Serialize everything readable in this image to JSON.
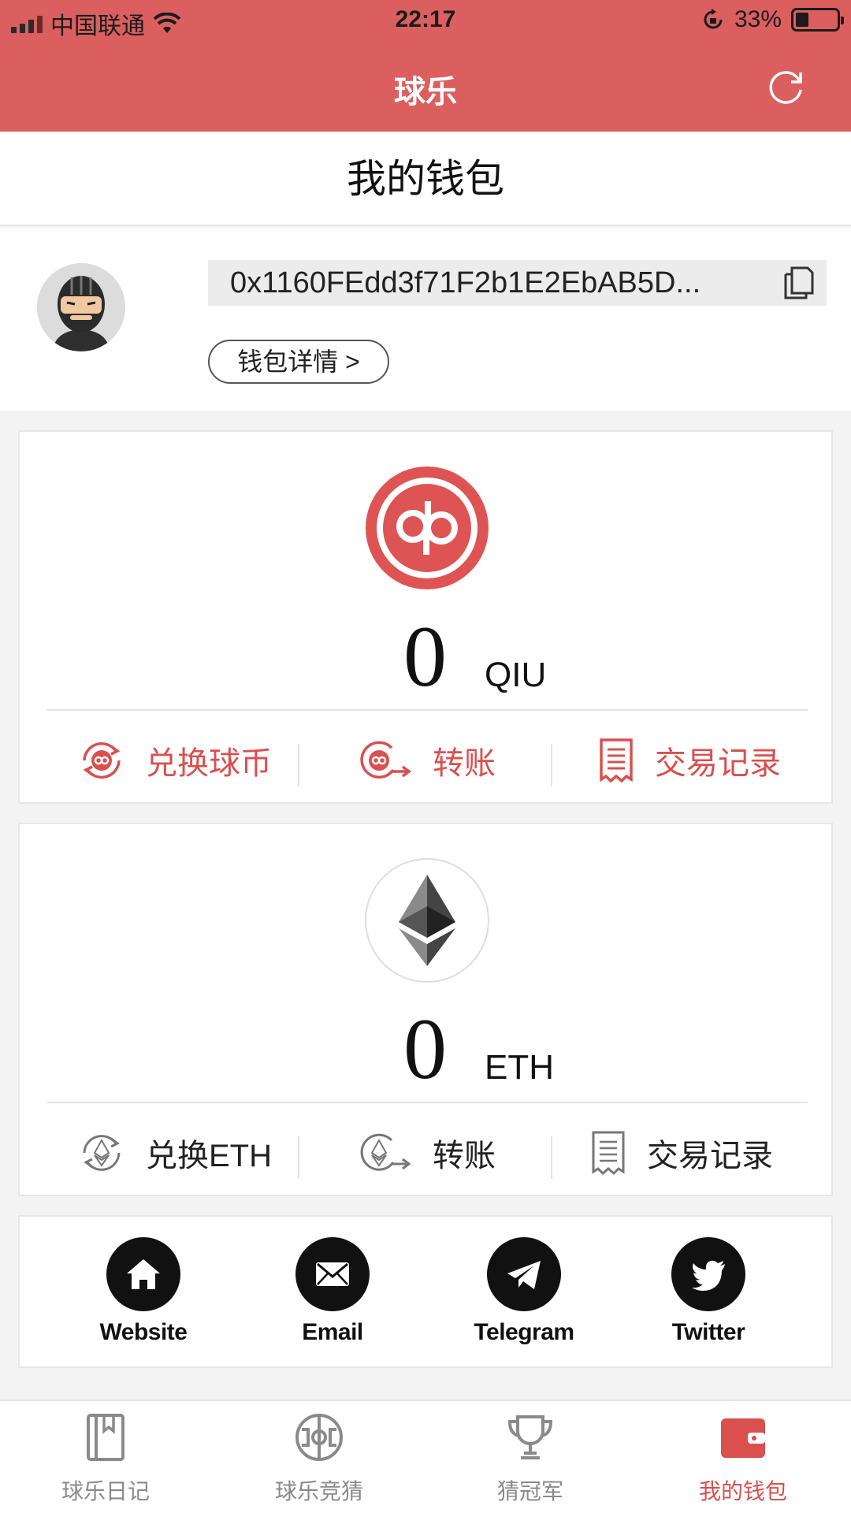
{
  "status_bar": {
    "carrier": "中国联通",
    "time": "22:17",
    "battery_percent": "33%"
  },
  "nav": {
    "title": "球乐",
    "refresh_icon": "refresh-icon"
  },
  "page_title": "我的钱包",
  "wallet": {
    "address": "0x1160FEdd3f71F2b1E2EbAB5D...",
    "detail_label": "钱包详情 >"
  },
  "coins": [
    {
      "amount": "0",
      "unit": "QIU",
      "accent": "#d9504f",
      "actions": [
        {
          "label": "兑换球币",
          "icon": "exchange-qiu-icon"
        },
        {
          "label": "转账",
          "icon": "transfer-qiu-icon"
        },
        {
          "label": "交易记录",
          "icon": "receipt-icon"
        }
      ]
    },
    {
      "amount": "0",
      "unit": "ETH",
      "accent": "#222222",
      "actions": [
        {
          "label": "兑换ETH",
          "icon": "exchange-eth-icon"
        },
        {
          "label": "转账",
          "icon": "transfer-eth-icon"
        },
        {
          "label": "交易记录",
          "icon": "receipt-icon"
        }
      ]
    }
  ],
  "social": [
    {
      "label": "Website",
      "icon": "home-icon"
    },
    {
      "label": "Email",
      "icon": "mail-icon"
    },
    {
      "label": "Telegram",
      "icon": "telegram-icon"
    },
    {
      "label": "Twitter",
      "icon": "twitter-icon"
    }
  ],
  "tabs": [
    {
      "label": "球乐日记",
      "icon": "book-icon",
      "active": false
    },
    {
      "label": "球乐竞猜",
      "icon": "pitch-icon",
      "active": false
    },
    {
      "label": "猜冠军",
      "icon": "trophy-icon",
      "active": false
    },
    {
      "label": "我的钱包",
      "icon": "wallet-icon",
      "active": true
    }
  ],
  "colors": {
    "brand_red": "#db5f5f",
    "accent_red": "#d9504f",
    "inactive_tab": "#8a8a8a"
  }
}
